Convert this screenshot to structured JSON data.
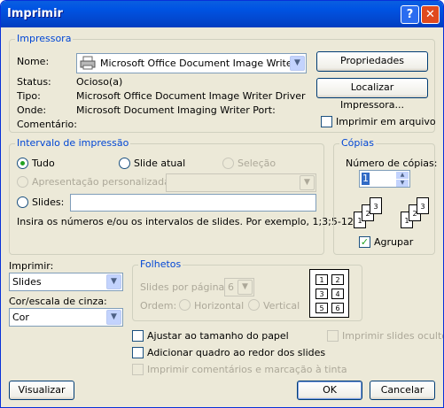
{
  "window": {
    "title": "Imprimir"
  },
  "printer": {
    "group_label": "Impressora",
    "name_label": "Nome:",
    "name_value": "Microsoft Office Document Image Writer",
    "properties_button": "Propriedades",
    "find_button": "Localizar Impressora...",
    "status_label": "Status:",
    "status_value": "Ocioso(a)",
    "type_label": "Tipo:",
    "type_value": "Microsoft Office Document Image Writer Driver",
    "where_label": "Onde:",
    "where_value": "Microsoft Document Imaging Writer Port:",
    "comment_label": "Comentário:",
    "print_to_file": "Imprimir em arquivo"
  },
  "range": {
    "group_label": "Intervalo de impressão",
    "all": "Tudo",
    "current": "Slide atual",
    "selection": "Seleção",
    "custom": "Apresentação personalizada:",
    "slides": "Slides:",
    "hint": "Insira os números e/ou os intervalos de slides. Por exemplo, 1;3;5-12"
  },
  "copies": {
    "group_label": "Cópias",
    "count_label": "Número de cópias:",
    "count_value": "1",
    "collate": "Agrupar",
    "pages_a": [
      "1",
      "2",
      "3"
    ],
    "pages_b": [
      "1",
      "2",
      "3"
    ]
  },
  "print_what": {
    "label": "Imprimir:",
    "value": "Slides"
  },
  "color": {
    "label": "Cor/escala de cinza:",
    "value": "Cor"
  },
  "handouts": {
    "group_label": "Folhetos",
    "per_page_label": "Slides por página:",
    "per_page_value": "6",
    "order_label": "Ordem:",
    "horizontal": "Horizontal",
    "vertical": "Vertical",
    "preview_cells": [
      "1",
      "2",
      "3",
      "4",
      "5",
      "6"
    ]
  },
  "options": {
    "scale": "Ajustar ao tamanho do papel",
    "frame": "Adicionar quadro ao redor dos slides",
    "comments": "Imprimir comentários e marcação à tinta",
    "hidden": "Imprimir slides ocultos"
  },
  "footer": {
    "preview": "Visualizar",
    "ok": "OK",
    "cancel": "Cancelar"
  }
}
